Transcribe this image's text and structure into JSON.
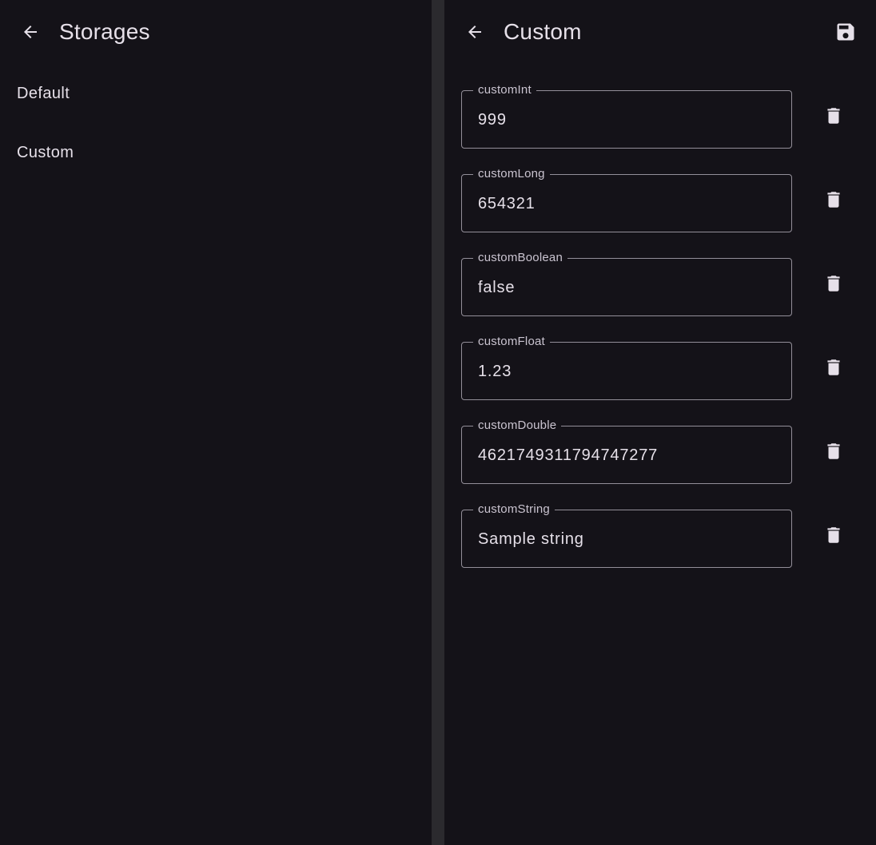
{
  "left_pane": {
    "title": "Storages",
    "back_icon": "arrow-back-icon",
    "items": [
      {
        "label": "Default"
      },
      {
        "label": "Custom"
      }
    ]
  },
  "right_pane": {
    "title": "Custom",
    "back_icon": "arrow-back-icon",
    "save_icon": "save-icon",
    "fields": [
      {
        "label": "customInt",
        "value": "999"
      },
      {
        "label": "customLong",
        "value": "654321"
      },
      {
        "label": "customBoolean",
        "value": "false"
      },
      {
        "label": "customFloat",
        "value": "1.23"
      },
      {
        "label": "customDouble",
        "value": "4621749311794747277"
      },
      {
        "label": "customString",
        "value": "Sample string"
      }
    ],
    "delete_icon": "delete-icon"
  },
  "colors": {
    "background": "#141218",
    "divider": "#2b2a2e",
    "text": "#e6e0e9",
    "outline": "#938f99"
  }
}
